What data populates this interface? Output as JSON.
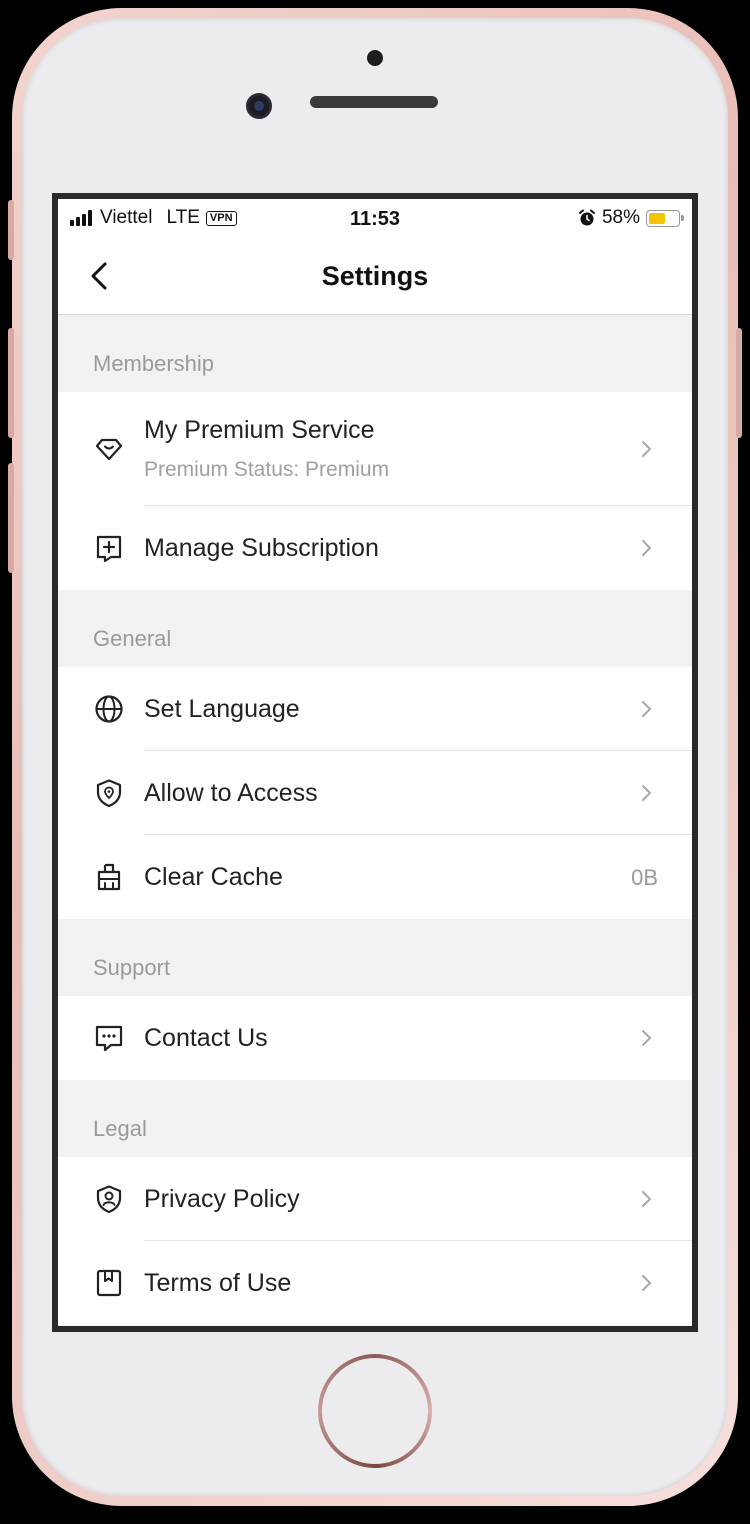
{
  "status_bar": {
    "carrier": "Viettel",
    "network": "LTE",
    "vpn": "VPN",
    "time": "11:53",
    "battery_percent_text": "58%",
    "battery_level": 0.58,
    "battery_color": "#f5c400"
  },
  "nav": {
    "title": "Settings",
    "back_icon": "chevron-left-icon"
  },
  "sections": [
    {
      "header": "Membership",
      "items": [
        {
          "label": "My Premium Service",
          "sublabel": "Premium Status: Premium",
          "icon": "diamond-heart-icon",
          "accessory": "chevron"
        },
        {
          "label": "Manage Subscription",
          "icon": "plus-bookmark-icon",
          "accessory": "chevron"
        }
      ]
    },
    {
      "header": "General",
      "items": [
        {
          "label": "Set Language",
          "icon": "globe-icon",
          "accessory": "chevron"
        },
        {
          "label": "Allow to Access",
          "icon": "shield-location-icon",
          "accessory": "chevron"
        },
        {
          "label": "Clear Cache",
          "icon": "broom-icon",
          "accessory_value": "0B"
        }
      ]
    },
    {
      "header": "Support",
      "items": [
        {
          "label": "Contact Us",
          "icon": "chat-bubble-icon",
          "accessory": "chevron"
        }
      ]
    },
    {
      "header": "Legal",
      "items": [
        {
          "label": "Privacy Policy",
          "icon": "shield-user-icon",
          "accessory": "chevron"
        },
        {
          "label": "Terms of Use",
          "icon": "book-icon",
          "accessory": "chevron"
        }
      ]
    }
  ]
}
